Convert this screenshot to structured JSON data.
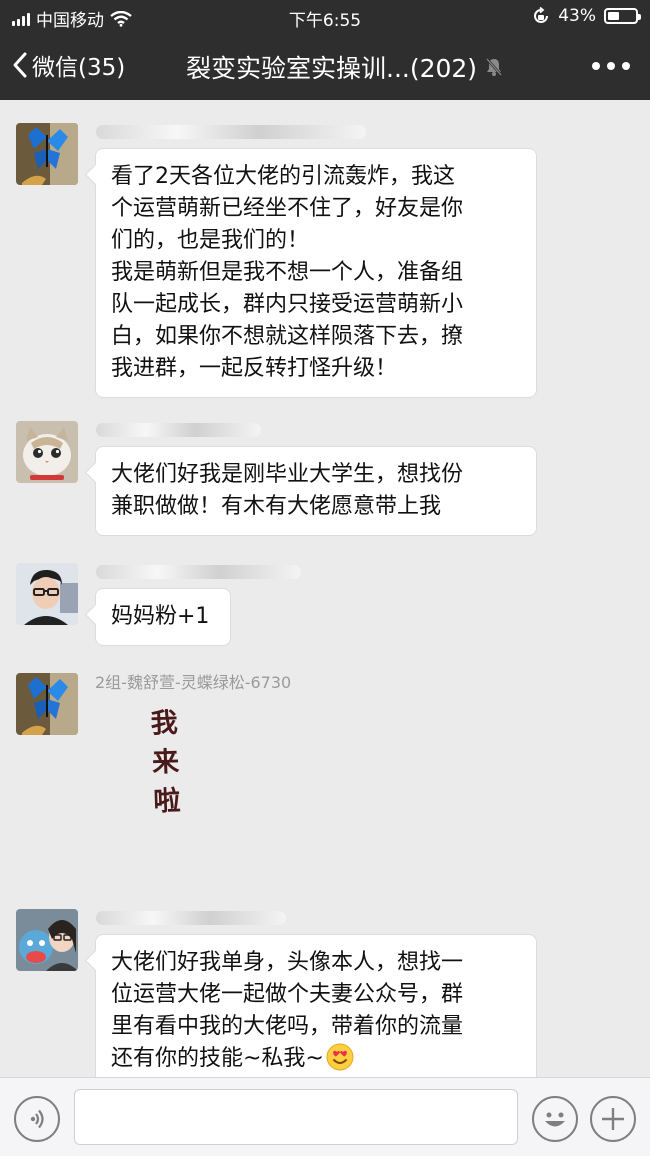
{
  "status_bar": {
    "carrier": "中国移动",
    "time": "下午6:55",
    "battery_percent_label": "43%",
    "battery_level": 0.43,
    "icons": [
      "signal-icon",
      "wifi-icon",
      "rotation-lock-icon",
      "battery-icon"
    ]
  },
  "nav": {
    "back_label": "微信(35)",
    "title": "裂变实验室实操训...(202)",
    "icons": [
      "back-chevron-icon",
      "mute-bell-icon",
      "more-icon"
    ]
  },
  "messages": [
    {
      "sender": "",
      "avatar": "butterfly-avatar",
      "lines": [
        "看了2天各位大佬的引流轰炸，我这",
        "个运营萌新已经坐不住了，好友是你",
        "们的，也是我们的！",
        "我是萌新但是我不想一个人，准备组",
        "队一起成长，群内只接受运营萌新小",
        "白，如果你不想就这样陨落下去，撩",
        "我进群，一起反转打怪升级！"
      ]
    },
    {
      "sender": "",
      "avatar": "cat-avatar",
      "lines": [
        "大佬们好我是刚毕业大学生，想找份",
        "兼职做做！有木有大佬愿意带上我"
      ]
    },
    {
      "sender": "",
      "avatar": "man-glasses-avatar",
      "lines": [
        "妈妈粉+1"
      ]
    },
    {
      "sender": "2组-魏舒萱-灵蝶绿松-6730",
      "avatar": "butterfly-avatar",
      "sticker_text": "我来啦"
    },
    {
      "sender": "",
      "avatar": "plush-toy-avatar",
      "lines": [
        "大佬们好我单身，头像本人，想找一",
        "位运营大佬一起做个夫妻公众号，群",
        "里有看中我的大佬吗，带着你的流量",
        "还有你的技能~私我~"
      ],
      "emoji": "heart-eyes-emoji"
    }
  ],
  "input_bar": {
    "icons": [
      "voice-icon",
      "emoji-icon",
      "plus-icon"
    ]
  },
  "colors": {
    "header_bg": "#2e2e2e",
    "chat_bg": "#ebebeb",
    "bubble_bg": "#ffffff",
    "input_bar_bg": "#f5f5f7"
  }
}
